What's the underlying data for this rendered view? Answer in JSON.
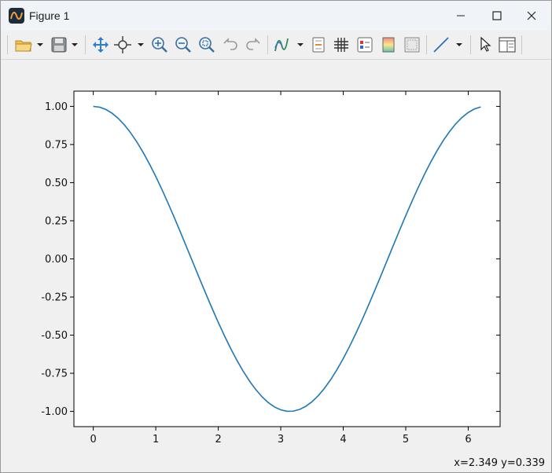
{
  "window": {
    "title": "Figure 1",
    "icon": "matplotlib-figure-icon"
  },
  "window_controls": [
    "minimize-icon",
    "maximize-icon",
    "close-icon"
  ],
  "toolbar": {
    "buttons": [
      "open-folder-icon",
      "save-disk-icon",
      "pan-move-icon",
      "zoom-target-icon",
      "zoom-in-icon",
      "zoom-out-icon",
      "zoom-fit-icon",
      "undo-icon",
      "redo-icon",
      "curve-style-icon",
      "edit-parameters-icon",
      "grid-icon",
      "legend-icon",
      "colorbar-icon",
      "image-frame-icon",
      "line-tool-icon",
      "cursor-select-icon",
      "panel-layout-icon"
    ]
  },
  "status": {
    "coordinates": "x=2.349 y=0.339"
  },
  "colors": {
    "line": "#1f77b4",
    "axes_frame": "#000000",
    "titlebar": "#f0f4f9",
    "toolbar": "#f0f0f0"
  },
  "chart_data": {
    "type": "line",
    "function": "cos(x)",
    "x_start": 0,
    "x_end": 6.2,
    "x_step": 0.1,
    "xlim": [
      -0.31,
      6.51
    ],
    "ylim": [
      -1.1,
      1.1
    ],
    "xticks": [
      "0",
      "1",
      "2",
      "3",
      "4",
      "5",
      "6"
    ],
    "yticks": [
      "1.00",
      "0.75",
      "0.50",
      "0.25",
      "0.00",
      "-0.25",
      "-0.50",
      "-0.75",
      "-1.00"
    ],
    "xtick_values": [
      0,
      1,
      2,
      3,
      4,
      5,
      6
    ],
    "ytick_values": [
      1.0,
      0.75,
      0.5,
      0.25,
      0.0,
      -0.25,
      -0.5,
      -0.75,
      -1.0
    ],
    "grid": false,
    "legend": "none",
    "title": "",
    "xlabel": "",
    "ylabel": ""
  }
}
